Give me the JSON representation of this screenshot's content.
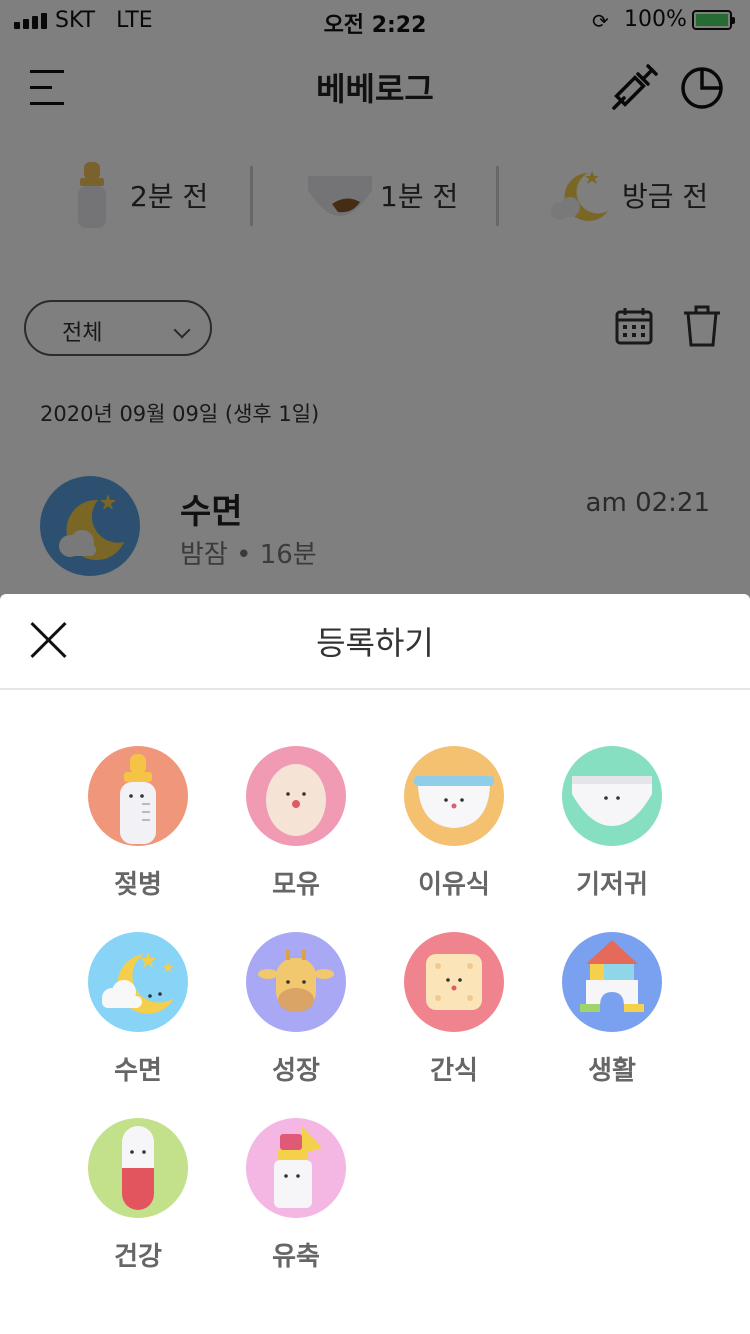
{
  "status_bar": {
    "carrier": "SKT",
    "network": "LTE",
    "time": "오전 2:22",
    "battery": "100%"
  },
  "header": {
    "title": "베베로그",
    "menu_icon": "hamburger-menu-icon",
    "syringe_icon": "syringe-icon",
    "stats_icon": "pie-chart-icon"
  },
  "recent": [
    {
      "icon": "baby-bottle-icon",
      "label": "2분 전"
    },
    {
      "icon": "diaper-icon",
      "label": "1분 전"
    },
    {
      "icon": "moon-sleep-icon",
      "label": "방금 전"
    }
  ],
  "filter": {
    "label": "전체"
  },
  "date_line": "2020년 09월 09일 (생후 1일)",
  "record": {
    "title": "수면",
    "sub": "밤잠 • 16분",
    "time": "am 02:21",
    "icon": "moon-sleep-icon"
  },
  "sheet": {
    "title": "등록하기",
    "items": [
      {
        "label": "젖병",
        "icon": "baby-bottle-icon",
        "color": "#f0967a"
      },
      {
        "label": "모유",
        "icon": "breastfeeding-icon",
        "color": "#f19ab3"
      },
      {
        "label": "이유식",
        "icon": "baby-food-bowl-icon",
        "color": "#f3c170"
      },
      {
        "label": "기저귀",
        "icon": "diaper-icon",
        "color": "#86dfc0"
      },
      {
        "label": "수면",
        "icon": "moon-sleep-icon",
        "color": "#88d4f6"
      },
      {
        "label": "성장",
        "icon": "giraffe-growth-icon",
        "color": "#a8a8f4"
      },
      {
        "label": "간식",
        "icon": "cracker-snack-icon",
        "color": "#f0848e"
      },
      {
        "label": "생활",
        "icon": "toy-blocks-icon",
        "color": "#7aa0f0"
      },
      {
        "label": "건강",
        "icon": "pill-capsule-icon",
        "color": "#c3e08a"
      },
      {
        "label": "유축",
        "icon": "breast-pump-icon",
        "color": "#f4b7e3"
      }
    ]
  }
}
